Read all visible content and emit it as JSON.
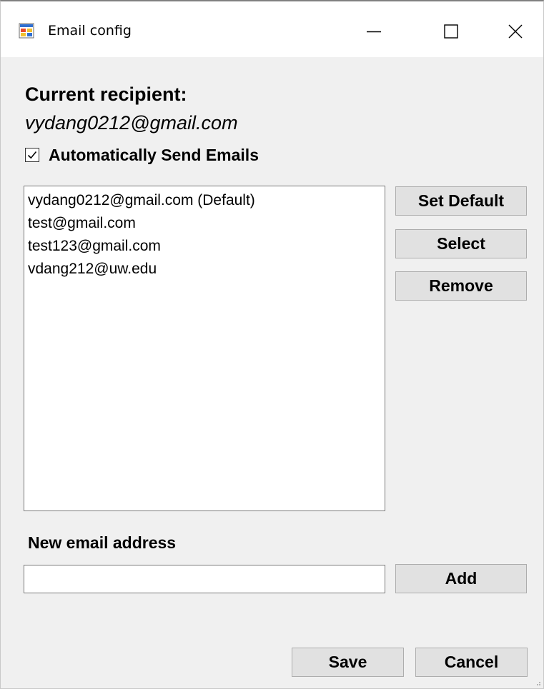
{
  "window": {
    "title": "Email config",
    "icon": "winforms-app-icon",
    "controls": {
      "minimize": "minimize-icon",
      "maximize": "maximize-icon",
      "close": "close-icon"
    }
  },
  "recipient": {
    "label": "Current recipient:",
    "email": "vydang0212@gmail.com"
  },
  "auto_send": {
    "label": "Automatically Send Emails",
    "checked": true
  },
  "email_list": {
    "items": [
      "vydang0212@gmail.com (Default)",
      "test@gmail.com",
      "test123@gmail.com",
      "vdang212@uw.edu"
    ]
  },
  "list_buttons": {
    "set_default": "Set Default",
    "select": "Select",
    "remove": "Remove"
  },
  "new_email": {
    "label": "New email address",
    "value": "",
    "add_button": "Add"
  },
  "footer": {
    "save": "Save",
    "cancel": "Cancel"
  }
}
